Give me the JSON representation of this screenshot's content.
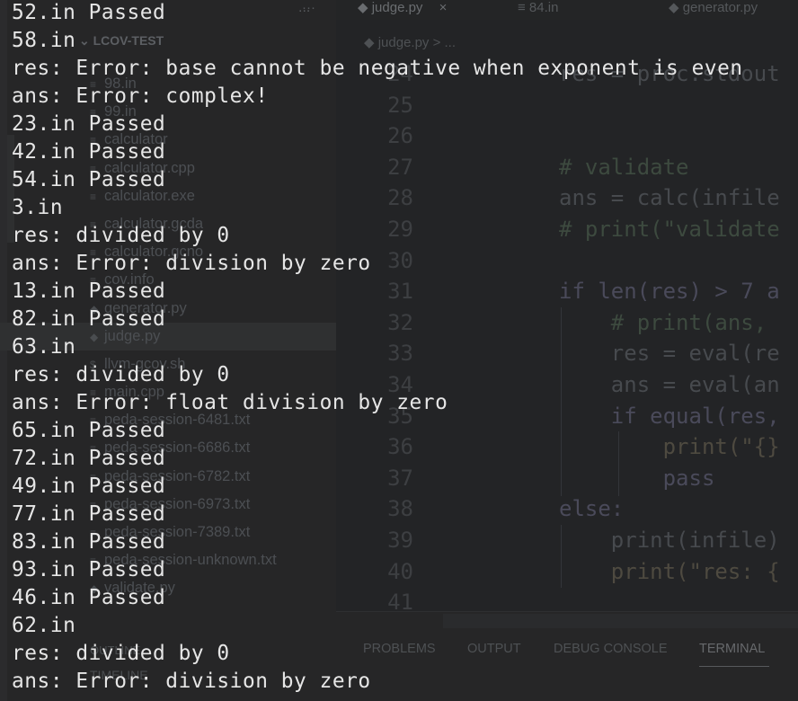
{
  "window": {
    "sidebar_title": "...",
    "project_name": "LCOV-TEST",
    "tabs": [
      {
        "label": "judge.py",
        "close": "×",
        "active": true
      },
      {
        "label": "84.in",
        "active": false
      },
      {
        "label": "generator.py",
        "active": false
      }
    ],
    "tab_more": "···",
    "breadcrumb": "judge.py > ..."
  },
  "explorer": {
    "files": [
      "98.in",
      "99.in",
      "calculator",
      "calculator.cpp",
      "calculator.exe",
      "calculator.gcda",
      "calculator.gcno",
      "cov.info",
      "generator.py",
      "judge.py",
      "llvm-gcov.sh",
      "main.cpp",
      "peda-session-6481.txt",
      "peda-session-6686.txt",
      "peda-session-6782.txt",
      "peda-session-6973.txt",
      "peda-session-7389.txt",
      "peda-session-unknown.txt",
      "validate.py"
    ],
    "active_file": "judge.py",
    "outline": "OUTLINE",
    "timeline": "TIMELINE"
  },
  "editor": {
    "line_numbers": [
      "24",
      "25",
      "26",
      "27",
      "28",
      "29",
      "30",
      "31",
      "32",
      "33",
      "34",
      "35",
      "36",
      "37",
      "38",
      "39",
      "40",
      "41"
    ],
    "lines": [
      "res = proc.stdout",
      "",
      "",
      "# validate",
      "ans = calc(infile",
      "# print(\"validate",
      "",
      "if len(res) > 7 a",
      "    # print(ans,",
      "    res = eval(re",
      "    ans = eval(an",
      "    if equal(res,",
      "        print(\"{}",
      "        pass",
      "else:",
      "    print(infile)",
      "    print(\"res: {",
      ""
    ]
  },
  "panel": {
    "tabs": [
      "PROBLEMS",
      "OUTPUT",
      "DEBUG CONSOLE",
      "TERMINAL"
    ],
    "active_tab": "TERMINAL"
  },
  "terminal": {
    "lines": [
      "52.in Passed",
      "58.in",
      "res: Error: base cannot be negative when exponent is even",
      "ans: Error: complex!",
      "23.in Passed",
      "42.in Passed",
      "54.in Passed",
      "3.in",
      "res: divided by 0",
      "ans: Error: division by zero",
      "13.in Passed",
      "82.in Passed",
      "63.in",
      "res: divided by 0",
      "ans: Error: float division by zero",
      "65.in Passed",
      "72.in Passed",
      "49.in Passed",
      "77.in Passed",
      "83.in Passed",
      "93.in Passed",
      "46.in Passed",
      "62.in",
      "res: divided by 0",
      "ans: Error: division by zero"
    ]
  },
  "colors": {
    "terminal_text": "#e6e6e6",
    "background": "#232425"
  }
}
